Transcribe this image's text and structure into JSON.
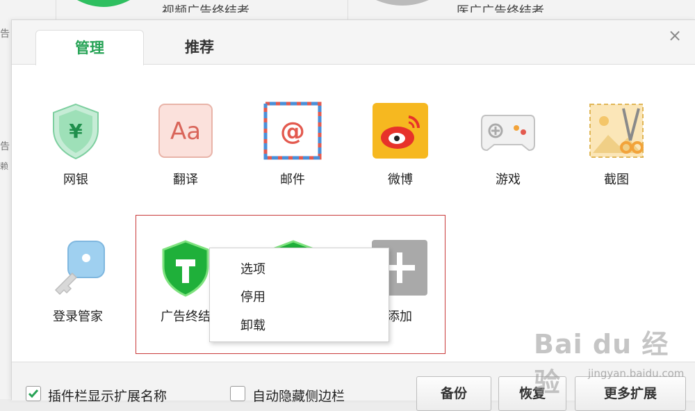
{
  "background_window": {
    "tab1_text": "视频广告终结者",
    "tab2_text": "医广广告终结者",
    "side_text_1": "告",
    "side_text_2": "告",
    "side_text_3": "赖"
  },
  "dialog": {
    "tabs": [
      {
        "label": "管理",
        "active": true
      },
      {
        "label": "推荐",
        "active": false
      }
    ],
    "close_symbol": "×"
  },
  "extensions": [
    {
      "label": "网银",
      "icon": "bank-shield-icon"
    },
    {
      "label": "翻译",
      "icon": "translate-icon"
    },
    {
      "label": "邮件",
      "icon": "mail-icon"
    },
    {
      "label": "微博",
      "icon": "weibo-icon"
    },
    {
      "label": "游戏",
      "icon": "gamepad-icon"
    },
    {
      "label": "截图",
      "icon": "screenshot-icon"
    },
    {
      "label": "登录管家",
      "icon": "key-icon"
    },
    {
      "label": "广告终结",
      "icon": "ad-blocker-shield-icon"
    },
    {
      "label": "",
      "icon": "ad-blocker-shield-icon"
    },
    {
      "label": "添加",
      "icon": "add-icon"
    }
  ],
  "context_menu": {
    "items": [
      "选项",
      "停用",
      "卸载"
    ]
  },
  "footer": {
    "show_names_label": "插件栏显示扩展名称",
    "show_names_checked": true,
    "auto_hide_label": "自动隐藏侧边栏",
    "auto_hide_checked": false,
    "backup_label": "备份",
    "restore_label": "恢复",
    "more_label": "更多扩展"
  },
  "watermark": {
    "text": "Bai du 经验",
    "sub": "jingyan.baidu.com"
  },
  "colors": {
    "accent": "#27a356",
    "selection_border": "#c83a3a"
  }
}
